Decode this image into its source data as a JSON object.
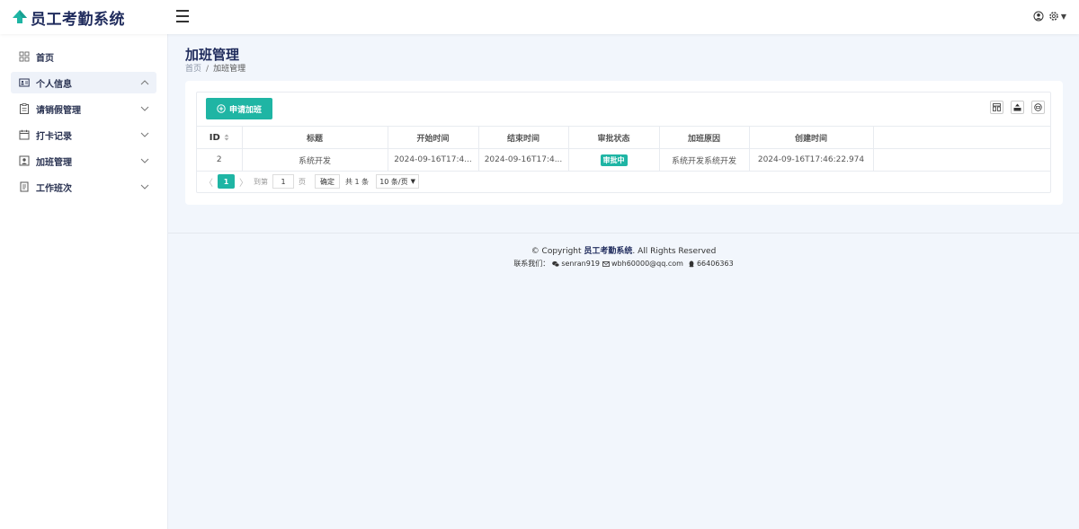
{
  "app": {
    "title": "员工考勤系统",
    "logo_icon": "tree-icon",
    "brand_color": "#1f2b5c",
    "accent_color": "#1fb5a4"
  },
  "header": {
    "menu_icon": "hamburger-icon",
    "user_icon": "user-icon",
    "settings_icon": "gear-icon"
  },
  "sidebar": {
    "items": [
      {
        "label": "首页",
        "icon": "dashboard-icon",
        "expandable": false,
        "active": false
      },
      {
        "label": "个人信息",
        "icon": "id-card-icon",
        "expandable": true,
        "active": true,
        "expanded": true
      },
      {
        "label": "请销假管理",
        "icon": "clipboard-icon",
        "expandable": true,
        "active": false
      },
      {
        "label": "打卡记录",
        "icon": "calendar-icon",
        "expandable": true,
        "active": false
      },
      {
        "label": "加班管理",
        "icon": "portrait-icon",
        "expandable": true,
        "active": false
      },
      {
        "label": "工作班次",
        "icon": "document-icon",
        "expandable": true,
        "active": false
      }
    ]
  },
  "page": {
    "title": "加班管理",
    "breadcrumb": [
      "首页",
      "/",
      "加班管理"
    ]
  },
  "toolbar": {
    "apply_label": "申请加班",
    "tools": [
      "columns-icon",
      "export-icon",
      "print-icon"
    ]
  },
  "table": {
    "columns": [
      "ID",
      "标题",
      "开始时间",
      "结束时间",
      "审批状态",
      "加班原因",
      "创建时间"
    ],
    "rows": [
      {
        "id": "2",
        "title": "系统开发",
        "start": "2024-09-16T17:4...",
        "end": "2024-09-16T17:4...",
        "status": "审批中",
        "reason": "系统开发系统开发",
        "created": "2024-09-16T17:46:22.974"
      }
    ]
  },
  "pager": {
    "prev": "〈",
    "next": "〉",
    "current_page": "1",
    "goto_prefix": "到第",
    "goto_value": "1",
    "goto_suffix": "页",
    "confirm": "确定",
    "total": "共 1 条",
    "page_size": "10 条/页"
  },
  "footer": {
    "copyright_prefix": "© Copyright",
    "copyright_brand": "员工考勤系统",
    "copyright_suffix": ". All Rights Reserved",
    "contact_label": "联系我们：",
    "wechat": "senran919",
    "email": "wbh60000@qq.com",
    "qq": "66406363"
  }
}
